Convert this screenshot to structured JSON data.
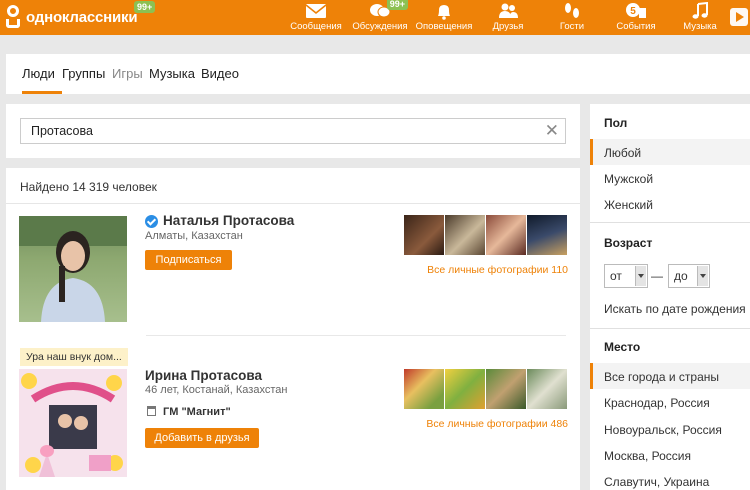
{
  "header": {
    "logo_text": "одноклассники",
    "logo_badge": "99+",
    "nav": [
      {
        "label": "Сообщения",
        "icon": "envelope-icon",
        "badge": ""
      },
      {
        "label": "Обсуждения",
        "icon": "chat-bubbles-icon",
        "badge": "99+"
      },
      {
        "label": "Оповещения",
        "icon": "bell-icon",
        "badge": ""
      },
      {
        "label": "Друзья",
        "icon": "friends-icon",
        "badge": ""
      },
      {
        "label": "Гости",
        "icon": "footprints-icon",
        "badge": ""
      },
      {
        "label": "События",
        "icon": "events-icon",
        "badge": ""
      },
      {
        "label": "Музыка",
        "icon": "music-note-icon",
        "badge": ""
      }
    ]
  },
  "tabs": [
    {
      "label": "Люди",
      "active": true
    },
    {
      "label": "Группы",
      "active": false
    },
    {
      "label": "Игры",
      "active": false
    },
    {
      "label": "Музыка",
      "active": false
    },
    {
      "label": "Видео",
      "active": false
    }
  ],
  "search": {
    "value": "Протасова",
    "clear": "✕"
  },
  "results": {
    "found_text": "Найдено 14 319 человек",
    "people": [
      {
        "name": "Наталья Протасова",
        "meta": "Алматы, Казахстан",
        "button": "Подписаться",
        "photos_link": "Все личные фотографии 110",
        "status": "",
        "work": ""
      },
      {
        "name": "Ирина Протасова",
        "meta": "46 лет, Костанай, Казахстан",
        "button": "Добавить в друзья",
        "photos_link": "Все личные фотографии 486",
        "status": "Ура наш внук дом...",
        "work": "ГМ \"Магнит\""
      }
    ]
  },
  "filters": {
    "gender": {
      "title": "Пол",
      "options": [
        "Любой",
        "Мужской",
        "Женский"
      ],
      "selected": "Любой"
    },
    "age": {
      "title": "Возраст",
      "from": "от",
      "dash": "—",
      "to": "до",
      "birthday_link": "Искать по дате рождения"
    },
    "place": {
      "title": "Место",
      "options": [
        "Все города и страны",
        "Краснодар, Россия",
        "Новоуральск, Россия",
        "Москва, Россия",
        "Славутич, Украина"
      ],
      "selected": "Все города и страны"
    }
  },
  "colors": {
    "brand": "#ee8208",
    "badge": "#8cc152",
    "verified": "#2b8ee5"
  }
}
